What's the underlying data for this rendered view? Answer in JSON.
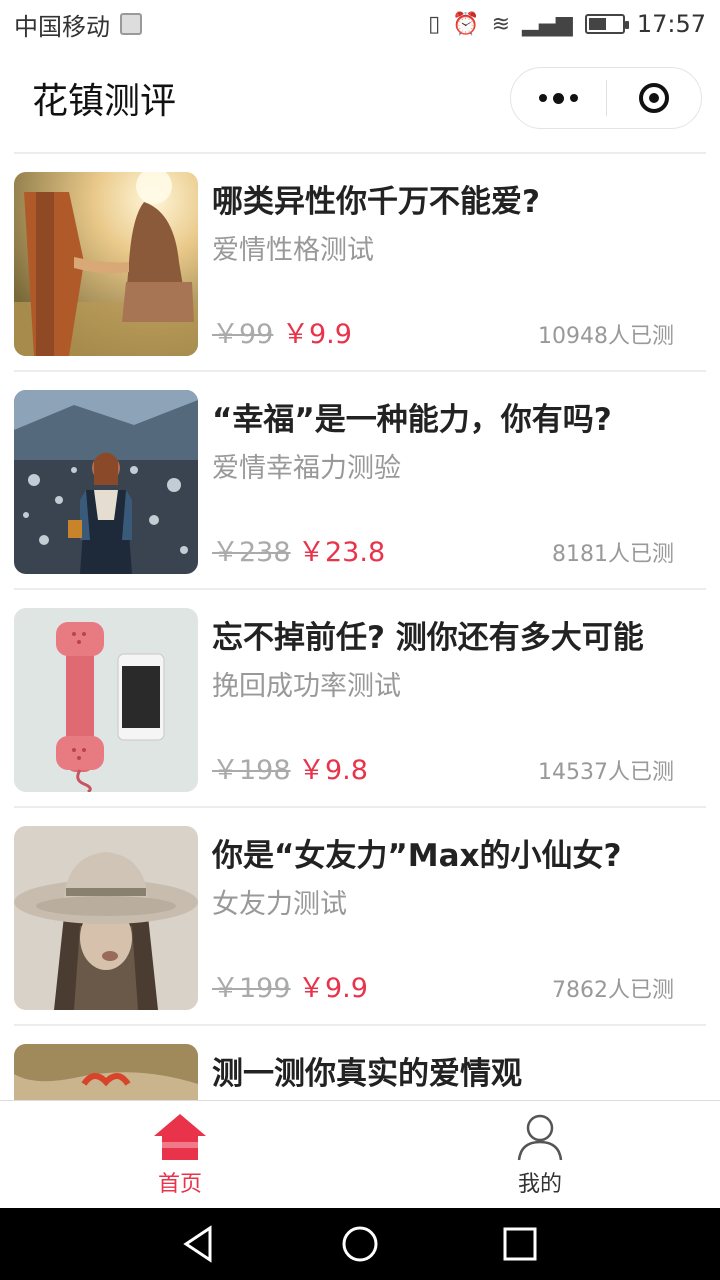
{
  "status_bar": {
    "carrier": "中国移动",
    "time": "17:57",
    "battery_level": 0.55
  },
  "header": {
    "title": "花镇测评",
    "menu_icon": "more-dots-icon",
    "close_icon": "target-icon"
  },
  "items": [
    {
      "title": "哪类异性你千万不能爱?",
      "subtitle": "爱情性格测试",
      "old_price": "￥99",
      "new_price": "￥9.9",
      "count": "10948人已测",
      "thumb": "couple-holding-hands"
    },
    {
      "title": "“幸福”是一种能力，你有吗?",
      "subtitle": "爱情幸福力测验",
      "old_price": "￥238",
      "new_price": "￥23.8",
      "count": "8181人已测",
      "thumb": "woman-bokeh"
    },
    {
      "title": "忘不掉前任? 测你还有多大可能",
      "subtitle": "挽回成功率测试",
      "old_price": "￥198",
      "new_price": "￥9.8",
      "count": "14537人已测",
      "thumb": "pink-phone"
    },
    {
      "title": "你是“女友力”Max的小仙女?",
      "subtitle": "女友力测试",
      "old_price": "￥199",
      "new_price": "￥9.9",
      "count": "7862人已测",
      "thumb": "woman-hat"
    },
    {
      "title": "测一测你真实的爱情观",
      "subtitle": "",
      "old_price": "",
      "new_price": "",
      "count": "",
      "thumb": "gift"
    }
  ],
  "tabbar": {
    "home_label": "首页",
    "mine_label": "我的",
    "active_color": "#e8334a"
  }
}
